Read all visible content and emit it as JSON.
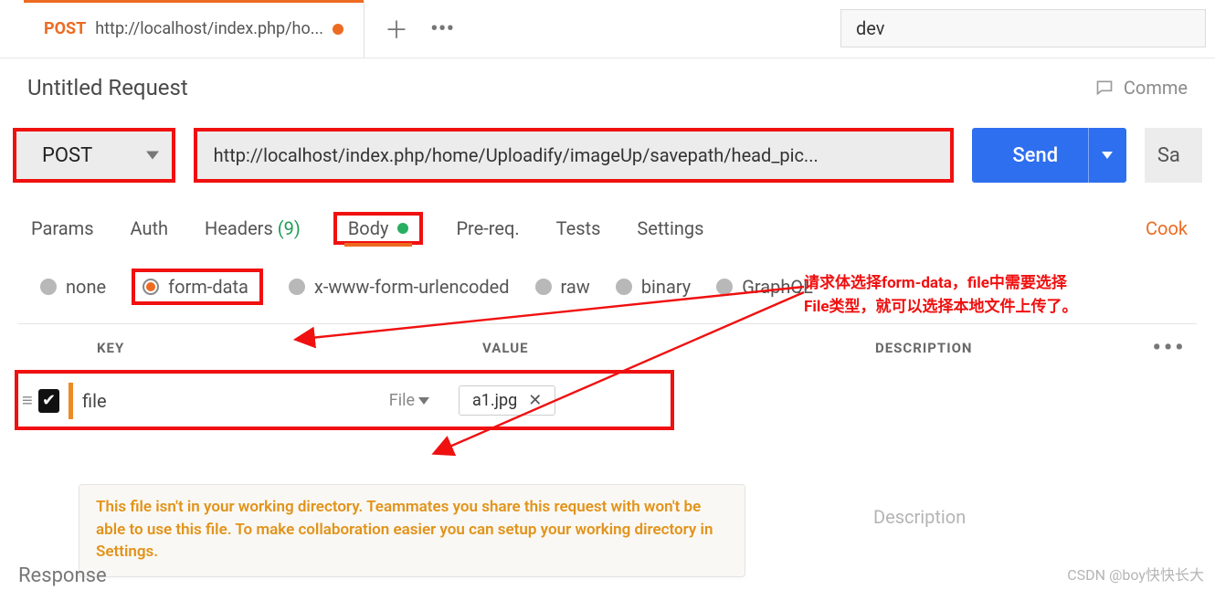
{
  "env": {
    "name": "dev"
  },
  "tab": {
    "method": "POST",
    "url_abbrev": "http://localhost/index.php/ho..."
  },
  "title": "Untitled Request",
  "comments_label": "Comme",
  "request": {
    "method": "POST",
    "url": "http://localhost/index.php/home/Uploadify/imageUp/savepath/head_pic...",
    "send_label": "Send",
    "save_label": "Sa"
  },
  "subtabs": {
    "params": "Params",
    "auth": "Auth",
    "headers": "Headers",
    "headers_count": "(9)",
    "body": "Body",
    "prereq": "Pre-req.",
    "tests": "Tests",
    "settings": "Settings",
    "cookies": "Cook"
  },
  "annotation": {
    "line1": "请求体选择form-data，file中需要选择",
    "line2": "File类型，就可以选择本地文件上传了。"
  },
  "body_types": {
    "none": "none",
    "form_data": "form-data",
    "xwww": "x-www-form-urlencoded",
    "raw": "raw",
    "binary": "binary",
    "graphql": "GraphQL"
  },
  "fd_headers": {
    "key": "KEY",
    "value": "VALUE",
    "description": "DESCRIPTION"
  },
  "fd_row": {
    "key": "file",
    "type_label": "File",
    "filename": "a1.jpg"
  },
  "desc_placeholder": "Description",
  "warning": "This file isn't in your working directory. Teammates you share this request with won't be able to use this file. To make collaboration easier you can setup your working directory in Settings.",
  "response_label": "Response",
  "watermark": "CSDN @boy快快长大"
}
